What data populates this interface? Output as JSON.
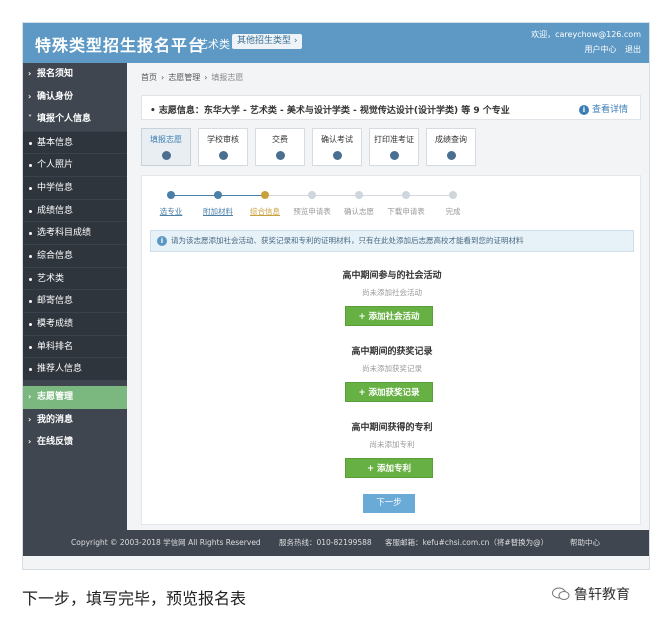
{
  "header": {
    "title": "特殊类型招生报名平台",
    "category": "艺术类",
    "switch_label": "其他招生类型 ›",
    "welcome": "欢迎，careychow@126.com",
    "user_center": "用户中心",
    "logout": "退出"
  },
  "sidebar": {
    "top_items": [
      {
        "label": "报名须知"
      },
      {
        "label": "确认身份"
      },
      {
        "label": "填报个人信息"
      }
    ],
    "sub_items": [
      {
        "label": "基本信息"
      },
      {
        "label": "个人照片"
      },
      {
        "label": "中学信息"
      },
      {
        "label": "成绩信息"
      },
      {
        "label": "选考科目成绩"
      },
      {
        "label": "综合信息"
      },
      {
        "label": "艺术类"
      },
      {
        "label": "邮寄信息"
      },
      {
        "label": "模考成绩"
      },
      {
        "label": "单科排名"
      },
      {
        "label": "推荐人信息"
      }
    ],
    "bottom_items": [
      {
        "label": "志愿管理"
      },
      {
        "label": "我的消息"
      },
      {
        "label": "在线反馈"
      }
    ]
  },
  "breadcrumb": {
    "home": "首页",
    "section": "志愿管理",
    "current": "填报志愿"
  },
  "info_bar": {
    "text": "• 志愿信息：东华大学 - 艺术类 - 美术与设计学类 - 视觉传达设计(设计学类) 等 9 个专业",
    "view_label": "查看详情"
  },
  "tabs": [
    {
      "label": "填报志愿"
    },
    {
      "label": "学校审核"
    },
    {
      "label": "交费"
    },
    {
      "label": "确认考试"
    },
    {
      "label": "打印准考证"
    },
    {
      "label": "成绩查询"
    }
  ],
  "steps": [
    {
      "label": "选专业",
      "state": "done"
    },
    {
      "label": "附加材料",
      "state": "done"
    },
    {
      "label": "综合信息",
      "state": "current"
    },
    {
      "label": "预览申请表",
      "state": "todo"
    },
    {
      "label": "确认志愿",
      "state": "todo"
    },
    {
      "label": "下载申请表",
      "state": "todo"
    },
    {
      "label": "完成",
      "state": "todo"
    }
  ],
  "notice": "请为该志愿添加社会活动、获奖记录和专利的证明材料，只有在此处添加后志愿高校才能看到您的证明材料",
  "sections": [
    {
      "title": "高中期间参与的社会活动",
      "empty": "尚未添加社会活动",
      "button": "+ 添加社会活动"
    },
    {
      "title": "高中期间的获奖记录",
      "empty": "尚未添加获奖记录",
      "button": "+ 添加获奖记录"
    },
    {
      "title": "高中期间获得的专利",
      "empty": "尚未添加专利",
      "button": "+ 添加专利"
    }
  ],
  "next_button": "下一步",
  "footer": {
    "copyright": "Copyright © 2003-2018 学信网 All Rights Reserved",
    "hotline": "服务热线：010-82199588",
    "email": "客服邮箱：kefu#chsi.com.cn（将#替换为@）",
    "help": "帮助中心"
  },
  "caption": "下一步，填写完毕，预览报名表",
  "brand": "鲁轩教育",
  "colors": {
    "header": "#5d99c4",
    "sidebar": "#3f4650",
    "sidebar_active": "#7ab87f",
    "step_done": "#4a7fa8",
    "step_current": "#c9a13a",
    "add_button": "#67b043",
    "next_button": "#6aaad6"
  }
}
